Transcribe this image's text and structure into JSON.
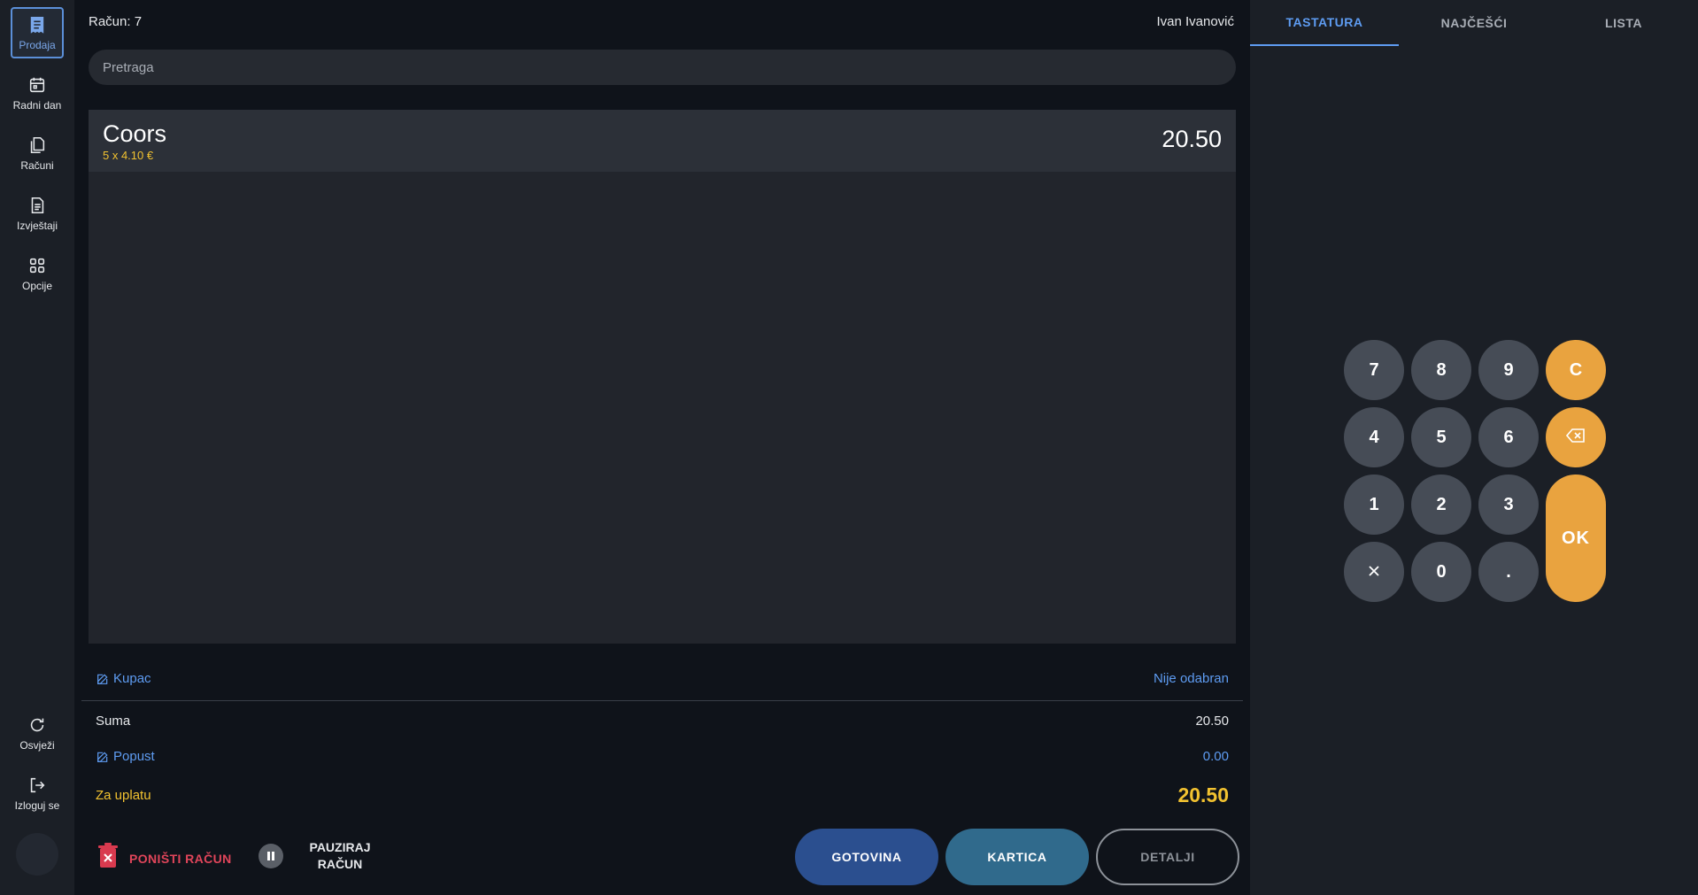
{
  "sidebar": {
    "items": [
      {
        "label": "Prodaja",
        "icon": "receipt-icon",
        "active": true
      },
      {
        "label": "Radni dan",
        "icon": "calendar-icon",
        "active": false
      },
      {
        "label": "Računi",
        "icon": "documents-icon",
        "active": false
      },
      {
        "label": "Izvještaji",
        "icon": "report-icon",
        "active": false
      },
      {
        "label": "Opcije",
        "icon": "grid-icon",
        "active": false
      }
    ],
    "bottom": [
      {
        "label": "Osvježi",
        "icon": "refresh-icon"
      },
      {
        "label": "Izloguj se",
        "icon": "logout-icon"
      }
    ]
  },
  "header": {
    "receipt": "Račun: 7",
    "user": "Ivan Ivanović"
  },
  "search": {
    "placeholder": "Pretraga"
  },
  "cart": {
    "items": [
      {
        "name": "Coors",
        "qty_line": "5 x 4.10 €",
        "total": "20.50"
      }
    ]
  },
  "summary": {
    "customer_label": "Kupac",
    "customer_value": "Nije odabran",
    "sum_label": "Suma",
    "sum_value": "20.50",
    "discount_label": "Popust",
    "discount_value": "0.00",
    "due_label": "Za uplatu",
    "due_value": "20.50"
  },
  "actions": {
    "cancel_label": "PONIŠTI RAČUN",
    "pause_label": "PAUZIRAJ RAČUN",
    "cash_label": "GOTOVINA",
    "card_label": "KARTICA",
    "details_label": "DETALJI"
  },
  "tabs": [
    {
      "label": "TASTATURA",
      "active": true
    },
    {
      "label": "NAJČEŠĆI",
      "active": false
    },
    {
      "label": "LISTA",
      "active": false
    }
  ],
  "keypad": {
    "k7": "7",
    "k8": "8",
    "k9": "9",
    "clear": "C",
    "k4": "4",
    "k5": "5",
    "k6": "6",
    "k1": "1",
    "k2": "2",
    "k3": "3",
    "ok": "OK",
    "k0": "0",
    "dot": "."
  },
  "colors": {
    "accent": "#5e9cf2",
    "highlight": "#f2c230",
    "danger": "#e0455a",
    "keypad_orange": "#e9a33f"
  }
}
